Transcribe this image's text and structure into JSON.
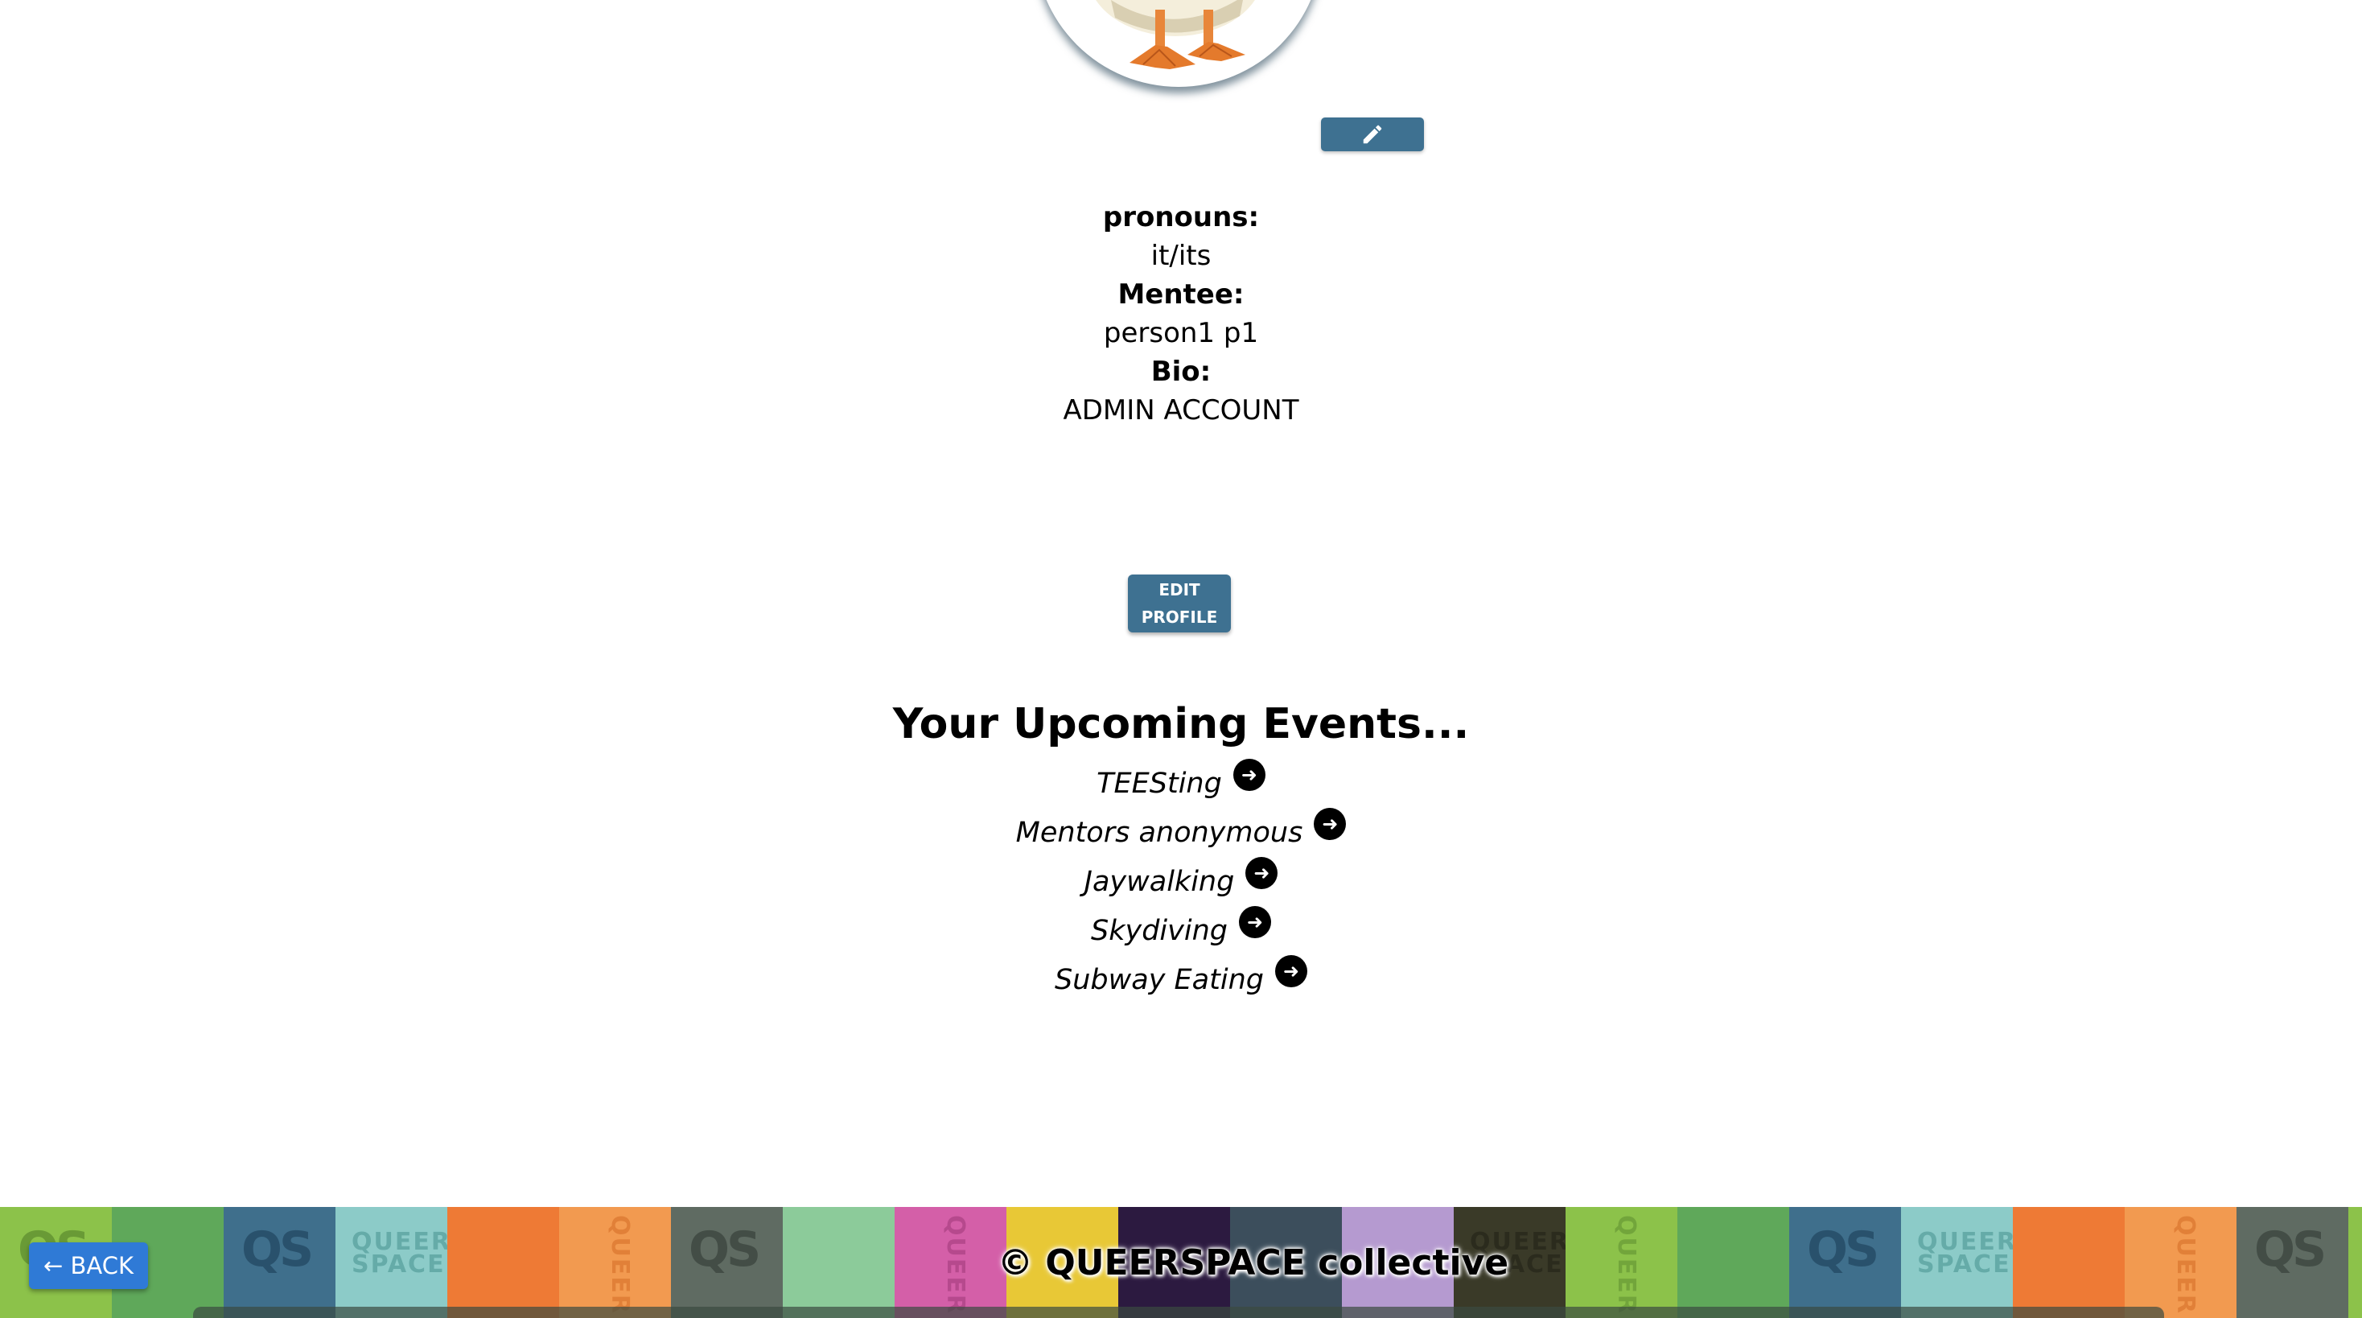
{
  "profile": {
    "pronouns_label": "pronouns:",
    "pronouns_value": "it/its",
    "mentee_label": "Mentee:",
    "mentee_value": "person1 p1",
    "bio_label": "Bio:",
    "bio_value": "ADMIN ACCOUNT",
    "edit_line1": "EDIT",
    "edit_line2": "PROFILE"
  },
  "events": {
    "title": "Your Upcoming Events...",
    "items": [
      {
        "name": "TEESting"
      },
      {
        "name": "Mentors anonymous"
      },
      {
        "name": "Jaywalking"
      },
      {
        "name": "Skydiving"
      },
      {
        "name": "Subway Eating"
      }
    ],
    "arrow_icon": "arrow-right-circle-icon"
  },
  "footer": {
    "title": "© QUEERSPACE collective",
    "back_label": "← BACK"
  },
  "colors": {
    "accent": "#3e7191",
    "back_button": "#2f7ad6"
  }
}
